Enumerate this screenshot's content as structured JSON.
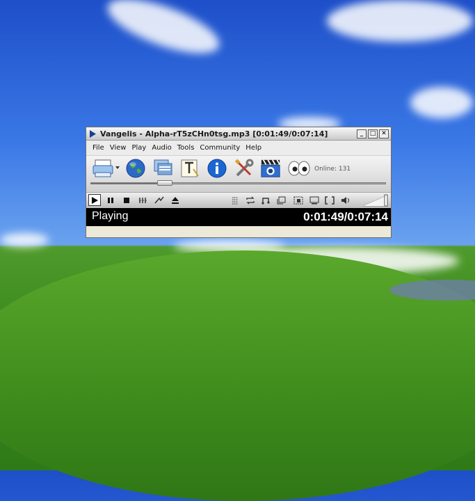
{
  "window": {
    "title": "Vangelis - Alpha-rT5zCHn0tsg.mp3 [0:01:49/0:07:14]",
    "buttons": {
      "minimize": "_",
      "maximize": "□",
      "close": "✕"
    }
  },
  "menu": [
    "File",
    "View",
    "Play",
    "Audio",
    "Tools",
    "Community",
    "Help"
  ],
  "toolbar": {
    "tools": [
      "printer-icon",
      "globe-icon",
      "playlist-icon",
      "text-icon",
      "info-icon",
      "tools-icon",
      "video-icon",
      "eyes-icon"
    ],
    "online_label": "Online: 131"
  },
  "playback": {
    "progress": 0.251,
    "volume": 1.0
  },
  "status": {
    "state": "Playing",
    "time": "0:01:49/0:07:14"
  },
  "colors": {
    "status_bg": "#000000",
    "status_text": "#ffffff",
    "sky": "#3a78e6",
    "grass": "#3b8a1d"
  }
}
